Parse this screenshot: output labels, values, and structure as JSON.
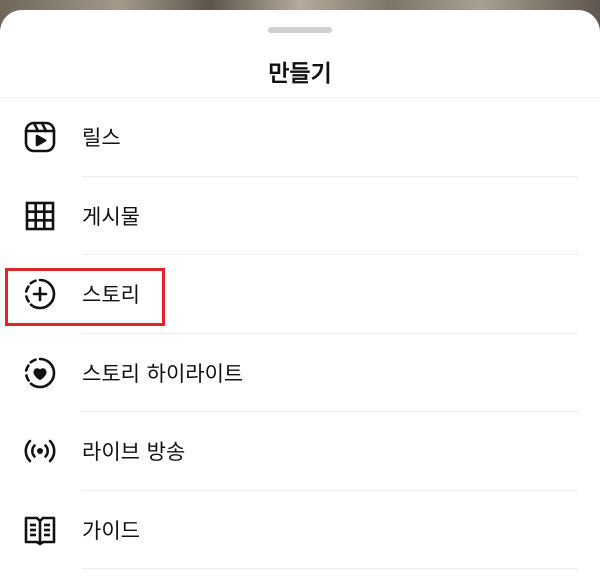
{
  "sheet": {
    "title": "만들기"
  },
  "menu": {
    "items": [
      {
        "label": "릴스",
        "icon": "reels-icon"
      },
      {
        "label": "게시물",
        "icon": "grid-icon"
      },
      {
        "label": "스토리",
        "icon": "story-add-icon"
      },
      {
        "label": "스토리 하이라이트",
        "icon": "highlight-heart-icon"
      },
      {
        "label": "라이브 방송",
        "icon": "live-broadcast-icon"
      },
      {
        "label": "가이드",
        "icon": "guide-book-icon"
      }
    ]
  },
  "colors": {
    "highlight_border": "#e0242c",
    "text": "#111111",
    "divider": "#ececec"
  }
}
